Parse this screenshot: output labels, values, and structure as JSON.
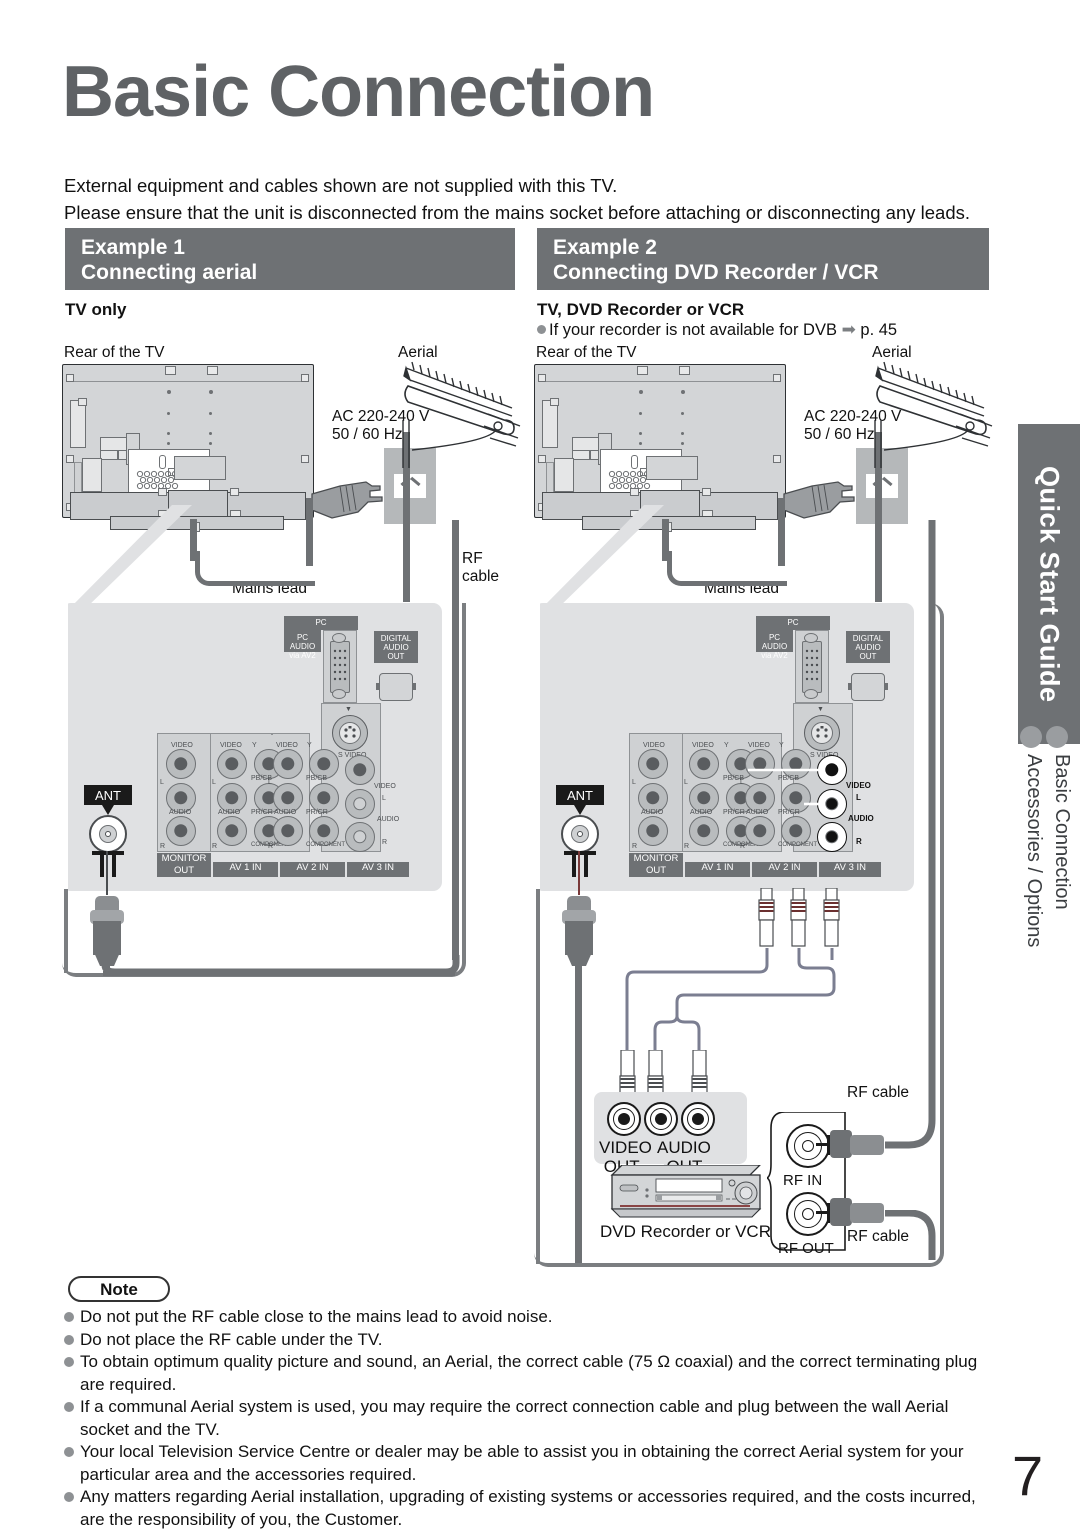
{
  "page": {
    "title": "Basic Connection",
    "page_number": "7",
    "intro_line1": "External equipment and cables shown are not supplied with this TV.",
    "intro_line2": "Please ensure that the unit is disconnected from the mains socket before attaching or disconnecting any leads."
  },
  "examples": [
    {
      "id": "example-1",
      "badge": "Example 1",
      "title": "Connecting aerial",
      "subheading": "TV only",
      "labels": {
        "rear_of_tv": "Rear of the TV",
        "aerial": "Aerial",
        "ac_line1": "AC 220-240 V",
        "ac_line2": "50 / 60 Hz",
        "mains_lead": "Mains lead",
        "rf_cable_line1": "RF",
        "rf_cable_line2": "cable"
      }
    },
    {
      "id": "example-2",
      "badge": "Example 2",
      "title": "Connecting DVD Recorder / VCR",
      "subheading": "TV, DVD Recorder or VCR",
      "note": "If your recorder is not available for DVB",
      "note_ref": "p. 45",
      "labels": {
        "rear_of_tv": "Rear of the TV",
        "aerial": "Aerial",
        "ac_line1": "AC 220-240 V",
        "ac_line2": "50 / 60 Hz",
        "mains_lead": "Mains lead",
        "video_out_l1": "VIDEO",
        "video_out_l2": "OUT",
        "audio_out_l1": "AUDIO",
        "audio_out_l2": "OUT",
        "device": "DVD Recorder or VCR",
        "rf_in": "RF IN",
        "rf_out": "RF OUT",
        "rf_cable_top": "RF cable",
        "rf_cable_bottom": "RF cable"
      }
    }
  ],
  "connector_panel": {
    "ant": "ANT",
    "pc": "PC",
    "pc_audio_l1": "PC AUDIO",
    "pc_audio_l2": "via AV2",
    "digital_audio_l1": "DIGITAL",
    "digital_audio_l2": "AUDIO",
    "digital_audio_l3": "OUT",
    "s_video": "S VIDEO",
    "video": "VIDEO",
    "audio": "AUDIO",
    "left": "L",
    "right": "R",
    "y": "Y",
    "pb_cb": "PB/CB",
    "pr_cr": "PR/CR",
    "component": "COMPONENT",
    "bands": [
      {
        "l1": "MONITOR",
        "l2": "OUT"
      },
      {
        "l1": "AV 1  IN",
        "l2": ""
      },
      {
        "l1": "AV 2  IN",
        "l2": ""
      },
      {
        "l1": "AV 3  IN",
        "l2": ""
      }
    ]
  },
  "note": {
    "badge": "Note",
    "items": [
      "Do not put the RF cable close to the mains lead to avoid noise.",
      "Do not place the RF cable under the TV.",
      "To obtain optimum quality picture and sound, an Aerial, the correct cable (75 Ω coaxial) and the correct terminating plug are required.",
      "If a communal Aerial system is used, you may require the correct connection cable and plug between the wall Aerial socket and the TV.",
      "Your local Television Service Centre or dealer may be able to assist you in obtaining the correct Aerial system for your particular area and the accessories required.",
      "Any matters regarding Aerial installation, upgrading of existing systems or accessories required, and the costs incurred, are the responsibility of you, the Customer."
    ]
  },
  "sidebar": {
    "tab_label": "Quick Start Guide",
    "items": [
      {
        "label": "Basic Connection"
      },
      {
        "label": "Accessories / Options"
      }
    ]
  },
  "colors": {
    "header_gray": "#6e7174",
    "title_gray": "#5f6265",
    "panel_gray": "#e0e1e3",
    "cable_gray": "#6e7174",
    "rca_cable": "#7b7e91"
  }
}
